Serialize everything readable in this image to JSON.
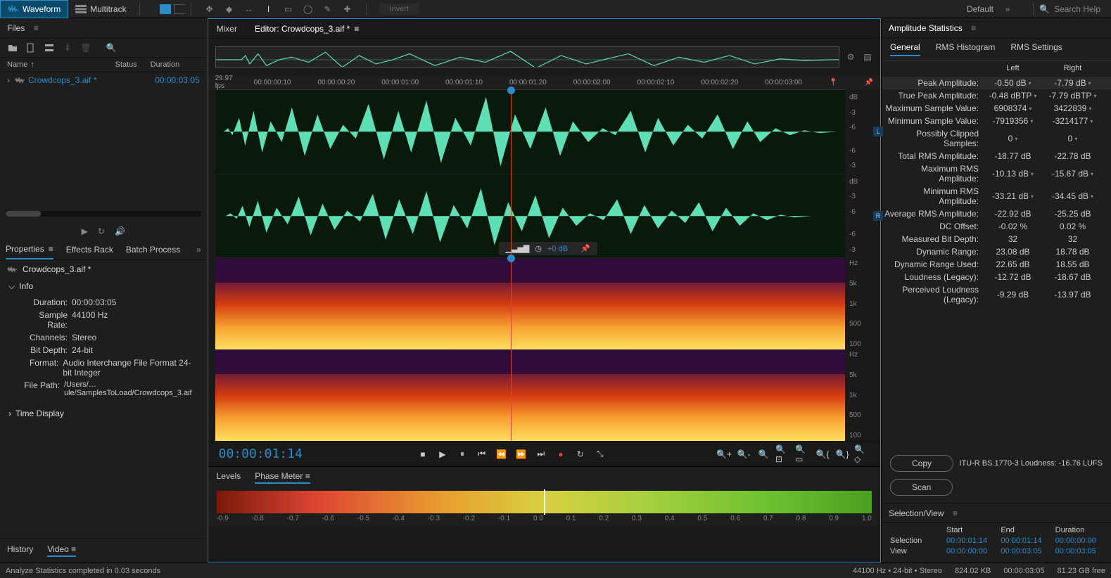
{
  "toolbar": {
    "waveform": "Waveform",
    "multitrack": "Multitrack",
    "invert": "Invert",
    "workspace": "Default",
    "search_placeholder": "Search Help"
  },
  "files": {
    "title": "Files",
    "col_name": "Name",
    "col_status": "Status",
    "col_duration": "Duration",
    "items": [
      {
        "name": "Crowdcops_3.aif *",
        "status": "",
        "duration": "00:00:03:05"
      }
    ]
  },
  "props": {
    "tab_properties": "Properties",
    "tab_effects": "Effects Rack",
    "tab_batch": "Batch Process",
    "title": "Crowdcops_3.aif *",
    "info_hdr": "Info",
    "duration_lbl": "Duration:",
    "duration_val": "00:00:03:05",
    "sr_lbl": "Sample Rate:",
    "sr_val": "44100 Hz",
    "ch_lbl": "Channels:",
    "ch_val": "Stereo",
    "bd_lbl": "Bit Depth:",
    "bd_val": "24-bit",
    "fmt_lbl": "Format:",
    "fmt_val": "Audio Interchange File Format 24-bit Integer",
    "fp_lbl": "File Path:",
    "fp_val": "/Users/…ule/SamplesToLoad/Crowdcops_3.aif",
    "time_hdr": "Time Display"
  },
  "bottom_tabs": {
    "history": "History",
    "video": "Video"
  },
  "editor": {
    "tab_mixer": "Mixer",
    "tab_editor": "Editor: Crowdcops_3.aif *",
    "fps": "29.97 fps",
    "ticks": [
      "00:00:00:10",
      "00:00:00:20",
      "00:00:01:00",
      "00:00:01:10",
      "00:00:01:20",
      "00:00:02:00",
      "00:00:02:10",
      "00:00:02:20",
      "00:00:03:00"
    ],
    "db_label": "dB",
    "db_ticks_L": [
      "-3",
      "-6",
      "",
      "-6",
      "-3"
    ],
    "ch_L": "L",
    "ch_R": "R",
    "hud_db": "+0 dB",
    "hz_label": "Hz",
    "hz_ticks": [
      "5k",
      "1k",
      "500",
      "100"
    ],
    "timecode": "00:00:01:14"
  },
  "levels": {
    "tab_levels": "Levels",
    "tab_phase": "Phase Meter",
    "scale": [
      "-0.9",
      "-0.8",
      "-0.7",
      "-0.6",
      "-0.5",
      "-0.4",
      "-0.3",
      "-0.2",
      "-0.1",
      "0.0",
      "0.1",
      "0.2",
      "0.3",
      "0.4",
      "0.5",
      "0.6",
      "0.7",
      "0.8",
      "0.9",
      "1.0"
    ]
  },
  "amp": {
    "title": "Amplitude Statistics",
    "tab_general": "General",
    "tab_hist": "RMS Histogram",
    "tab_settings": "RMS Settings",
    "left": "Left",
    "right": "Right",
    "rows": [
      {
        "l": "Peak Amplitude:",
        "a": "-0.50 dB",
        "b": "-7.79 dB",
        "hl": true,
        "tri": true
      },
      {
        "l": "True Peak Amplitude:",
        "a": "-0.48 dBTP",
        "b": "-7.79 dBTP",
        "tri": true
      },
      {
        "l": "Maximum Sample Value:",
        "a": "6908374",
        "b": "3422839",
        "tri": true
      },
      {
        "l": "Minimum Sample Value:",
        "a": "-7919356",
        "b": "-3214177",
        "tri": true
      },
      {
        "l": "Possibly Clipped Samples:",
        "a": "0",
        "b": "0",
        "tri": true
      },
      {
        "l": "Total RMS Amplitude:",
        "a": "-18.77 dB",
        "b": "-22.78 dB"
      },
      {
        "l": "Maximum RMS Amplitude:",
        "a": "-10.13 dB",
        "b": "-15.67 dB",
        "tri": true
      },
      {
        "l": "Minimum RMS Amplitude:",
        "a": "-33.21 dB",
        "b": "-34.45 dB",
        "tri": true
      },
      {
        "l": "Average RMS Amplitude:",
        "a": "-22.92 dB",
        "b": "-25.25 dB"
      },
      {
        "l": "DC Offset:",
        "a": "-0.02 %",
        "b": "0.02 %"
      },
      {
        "l": "Measured Bit Depth:",
        "a": "32",
        "b": "32"
      },
      {
        "l": "Dynamic Range:",
        "a": "23.08 dB",
        "b": "18.78 dB"
      },
      {
        "l": "Dynamic Range Used:",
        "a": "22.65 dB",
        "b": "18.55 dB"
      },
      {
        "l": "Loudness (Legacy):",
        "a": "-12.72 dB",
        "b": "-18.67 dB"
      },
      {
        "l": "Perceived Loudness (Legacy):",
        "a": "-9.29 dB",
        "b": "-13.97 dB"
      }
    ],
    "copy": "Copy",
    "scan": "Scan",
    "lufs": "ITU-R BS.1770-3 Loudness:  -16.76 LUFS"
  },
  "selview": {
    "title": "Selection/View",
    "start": "Start",
    "end": "End",
    "dur": "Duration",
    "sel_lbl": "Selection",
    "sel_s": "00:00:01:14",
    "sel_e": "00:00:01:14",
    "sel_d": "00:00:00:00",
    "view_lbl": "View",
    "view_s": "00:00:00:00",
    "view_e": "00:00:03:05",
    "view_d": "00:00:03:05"
  },
  "status": {
    "msg": "Analyze Statistics completed in 0.03 seconds",
    "sr": "44100 Hz • 24-bit • Stereo",
    "size": "824.02 KB",
    "dur": "00:00:03:05",
    "free": "81.23 GB free"
  }
}
